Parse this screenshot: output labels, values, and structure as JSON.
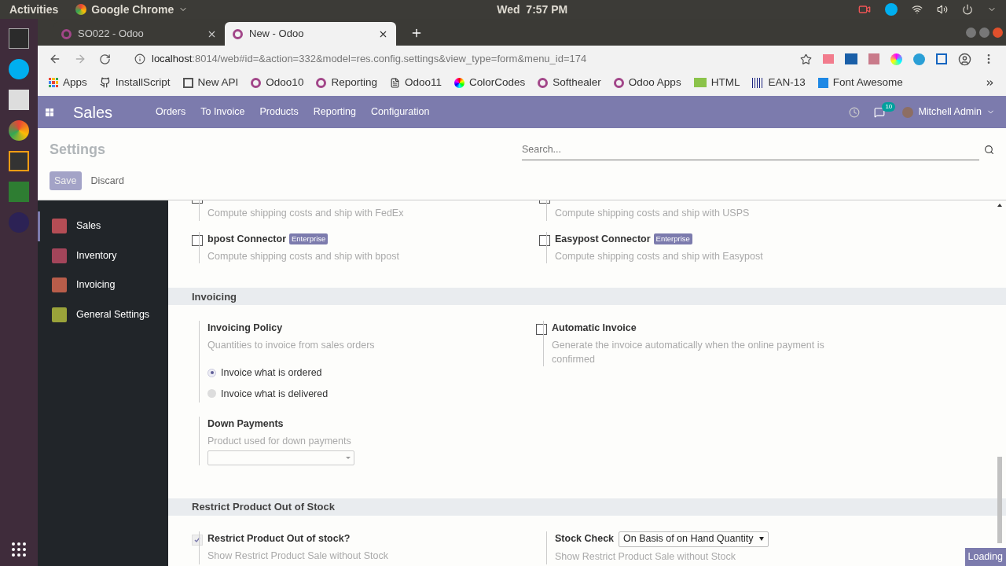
{
  "system_bar": {
    "activities": "Activities",
    "app": "Google Chrome",
    "clock": "Wed  7:57 PM"
  },
  "browser": {
    "tabs": [
      {
        "title": "SO022 - Odoo",
        "selected": false
      },
      {
        "title": "New - Odoo",
        "selected": true
      }
    ],
    "address": {
      "host": "localhost",
      "path": ":8014/web#id=&action=332&model=res.config.settings&view_type=form&menu_id=174"
    },
    "bookmarks": [
      "Apps",
      "InstallScript",
      "New API",
      "Odoo10",
      "Reporting",
      "Odoo11",
      "ColorCodes",
      "Softhealer",
      "Odoo Apps",
      "HTML",
      "EAN-13",
      "Font Awesome"
    ]
  },
  "navbar": {
    "app": "Sales",
    "menu": [
      "Orders",
      "To Invoice",
      "Products",
      "Reporting",
      "Configuration"
    ],
    "messages_badge": "10",
    "user": "Mitchell Admin"
  },
  "control_panel": {
    "title": "Settings",
    "search": {
      "placeholder": "Search..."
    },
    "save": "Save",
    "discard": "Discard"
  },
  "sidebar": {
    "items": [
      {
        "label": "Sales",
        "selected": true
      },
      {
        "label": "Inventory",
        "selected": false
      },
      {
        "label": "Invoicing",
        "selected": false
      },
      {
        "label": "General Settings",
        "selected": false
      }
    ]
  },
  "partial_rows": [
    {
      "description": "Compute shipping costs and ship with FedEx"
    },
    {
      "description": "Compute shipping costs and ship with USPS"
    }
  ],
  "connectors": [
    {
      "title": "bpost Connector",
      "badge": "Enterprise",
      "description": "Compute shipping costs and ship with bpost",
      "checked": false
    },
    {
      "title": "Easypost Connector",
      "badge": "Enterprise",
      "description": "Compute shipping costs and ship with Easypost",
      "checked": false
    }
  ],
  "invoicing": {
    "heading": "Invoicing",
    "policy": {
      "title": "Invoicing Policy",
      "description": "Quantities to invoice from sales orders",
      "options": [
        {
          "label": "Invoice what is ordered",
          "selected": true
        },
        {
          "label": "Invoice what is delivered",
          "selected": false
        }
      ]
    },
    "automatic": {
      "title": "Automatic Invoice",
      "description": "Generate the invoice automatically when the online payment is confirmed",
      "checked": false
    },
    "down_payments": {
      "title": "Down Payments",
      "description": "Product used for down payments"
    }
  },
  "restrict": {
    "heading": "Restrict Product Out of Stock",
    "option": {
      "title": "Restrict Product Out of stock?",
      "description": "Show Restrict Product Sale without Stock",
      "checked": true
    },
    "stock_check": {
      "label": "Stock Check",
      "value": "On Basis of on Hand Quantity",
      "description": "Show Restrict Product Sale without Stock"
    }
  },
  "loading": "Loading"
}
